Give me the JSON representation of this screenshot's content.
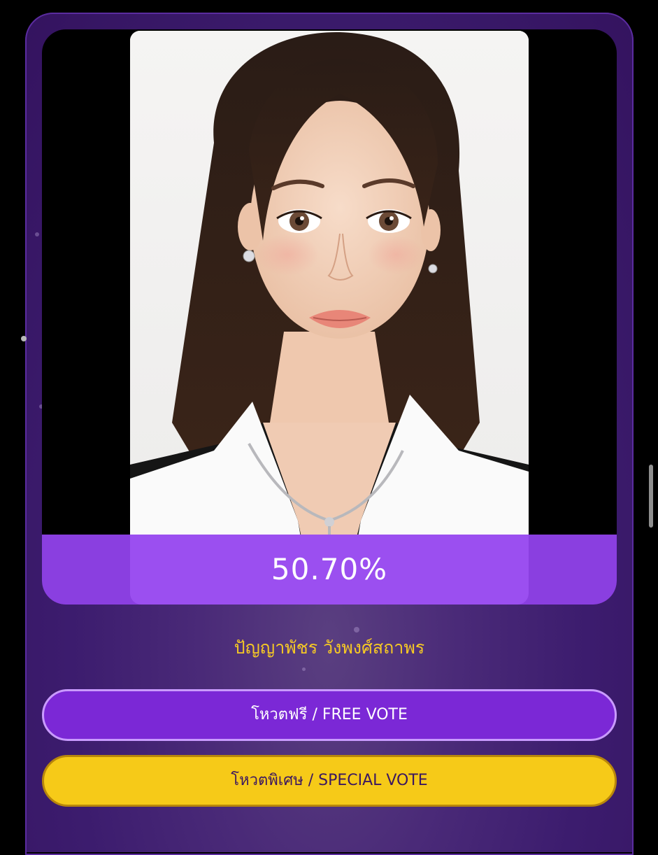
{
  "vote_card": {
    "percentage": "50.70%",
    "candidate_name": "ปัญญาพัชร วังพงศ์สถาพร",
    "free_vote_label": "โหวตฟรี / FREE VOTE",
    "special_vote_label": "โหวตพิเศษ / SPECIAL VOTE"
  },
  "colors": {
    "card_purple": "#3c1c6e",
    "percent_band": "#9b4ff0",
    "name_gold": "#f5c825",
    "free_button": "#7b28d6",
    "special_button": "#f6ca18"
  },
  "icons": {
    "portrait": "candidate-photo"
  }
}
